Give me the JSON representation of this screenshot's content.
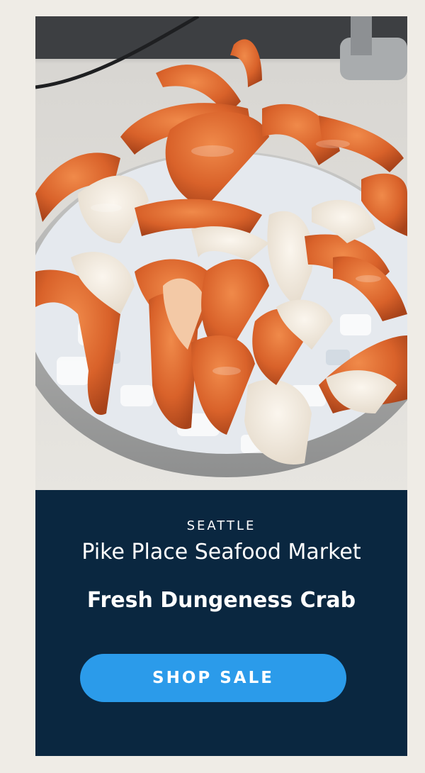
{
  "hero": {
    "image_subject": "crab-platter-photo"
  },
  "promo": {
    "city": "SEATTLE",
    "store_name": "Pike Place Seafood Market",
    "product": "Fresh Dungeness Crab",
    "cta_label": "SHOP SALE"
  },
  "colors": {
    "page_background": "#efece6",
    "card_background": "#0a2740",
    "button_background": "#2b9bea",
    "text": "#ffffff"
  }
}
